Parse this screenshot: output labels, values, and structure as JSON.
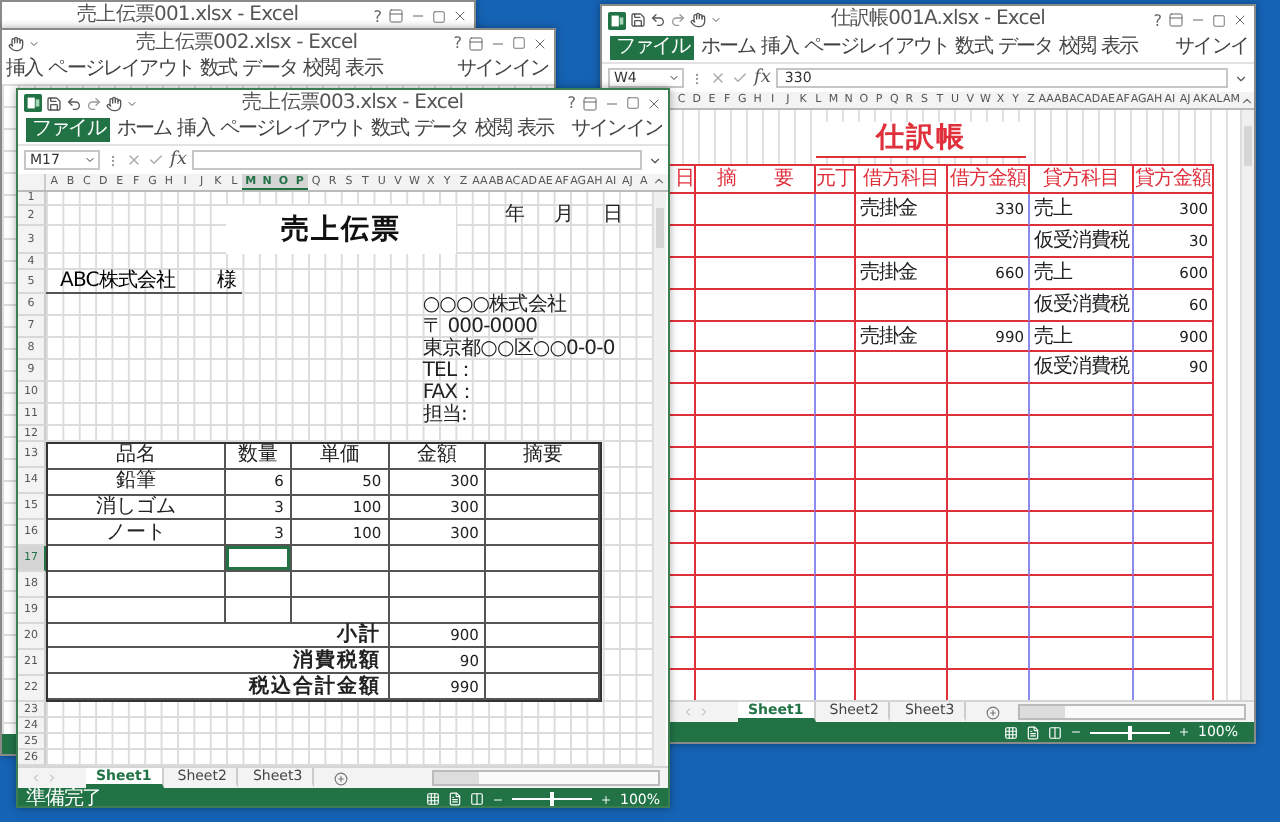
{
  "back_window": {
    "title": "売上伝票001.xlsx - Excel",
    "help": "?"
  },
  "middle_window": {
    "title": "売上伝票002.xlsx - Excel",
    "help": "?",
    "ribbon_tabs": [
      {
        "label": "挿入",
        "kind": "tab"
      },
      {
        "label": "ページレイアウト",
        "kind": "tab"
      },
      {
        "label": "数式",
        "kind": "tab"
      },
      {
        "label": "データ",
        "kind": "tab"
      },
      {
        "label": "校閲",
        "kind": "tab"
      },
      {
        "label": "表示",
        "kind": "tab"
      }
    ],
    "sign_in": "サインイン"
  },
  "journal_window": {
    "title": "仕訳帳001A.xlsx - Excel",
    "help": "?",
    "ribbon_tabs": [
      {
        "label": "ファイル",
        "kind": "file"
      },
      {
        "label": "ホーム",
        "kind": "tab"
      },
      {
        "label": "挿入",
        "kind": "tab"
      },
      {
        "label": "ページレイアウト",
        "kind": "tab"
      },
      {
        "label": "数式",
        "kind": "tab"
      },
      {
        "label": "データ",
        "kind": "tab"
      },
      {
        "label": "校閲",
        "kind": "tab"
      },
      {
        "label": "表示",
        "kind": "tab"
      }
    ],
    "sign_in": "サインイ",
    "name_box": "W4",
    "function_label": "fx",
    "formula": "330",
    "column_letters": [
      "C",
      "D",
      "E",
      "F",
      "G",
      "H",
      "I",
      "J",
      "K",
      "L",
      "M",
      "N",
      "O",
      "P",
      "Q",
      "R",
      "S",
      "T",
      "U",
      "V",
      "W",
      "X",
      "Y",
      "Z",
      "AA",
      "AB",
      "AC",
      "AD",
      "AE",
      "AF",
      "AG",
      "AH",
      "AI",
      "AJ",
      "AK",
      "AL",
      "AM"
    ],
    "sheet": {
      "title": "仕訳帳",
      "columns": [
        "日",
        "摘　　要",
        "元丁",
        "借方科目",
        "借方金額",
        "貸方科目",
        "貸方金額"
      ],
      "entries": [
        {
          "debit_account": "売掛金",
          "debit_amount": "330",
          "credit_account": "売上",
          "credit_amount": "300"
        },
        {
          "credit_account": "仮受消費税",
          "credit_amount": "30"
        },
        {
          "debit_account": "売掛金",
          "debit_amount": "660",
          "credit_account": "売上",
          "credit_amount": "600"
        },
        {
          "credit_account": "仮受消費税",
          "credit_amount": "60"
        },
        {
          "debit_account": "売掛金",
          "debit_amount": "990",
          "credit_account": "売上",
          "credit_amount": "900"
        },
        {
          "credit_account": "仮受消費税",
          "credit_amount": "90"
        }
      ]
    },
    "sheet_tabs": [
      {
        "label": "Sheet1",
        "selected": true
      },
      {
        "label": "Sheet2",
        "selected": false
      },
      {
        "label": "Sheet3",
        "selected": false
      }
    ],
    "zoom_slider": {
      "level": 0.5
    },
    "zoom": "100%"
  },
  "invoice_window": {
    "title": "売上伝票003.xlsx - Excel",
    "help": "?",
    "ribbon_tabs": [
      {
        "label": "ファイル",
        "kind": "file"
      },
      {
        "label": "ホーム",
        "kind": "tab"
      },
      {
        "label": "挿入",
        "kind": "tab"
      },
      {
        "label": "ページレイアウト",
        "kind": "tab"
      },
      {
        "label": "数式",
        "kind": "tab"
      },
      {
        "label": "データ",
        "kind": "tab"
      },
      {
        "label": "校閲",
        "kind": "tab"
      },
      {
        "label": "表示",
        "kind": "tab"
      }
    ],
    "sign_in": "サインイン",
    "name_box": "M17",
    "function_label": "fx",
    "column_letters": [
      {
        "label": "A",
        "selected": false
      },
      {
        "label": "B",
        "selected": false
      },
      {
        "label": "C",
        "selected": false
      },
      {
        "label": "D",
        "selected": false
      },
      {
        "label": "E",
        "selected": false
      },
      {
        "label": "F",
        "selected": false
      },
      {
        "label": "G",
        "selected": false
      },
      {
        "label": "H",
        "selected": false
      },
      {
        "label": "I",
        "selected": false
      },
      {
        "label": "J",
        "selected": false
      },
      {
        "label": "K",
        "selected": false
      },
      {
        "label": "L",
        "selected": false
      },
      {
        "label": "M",
        "selected": true
      },
      {
        "label": "N",
        "selected": true
      },
      {
        "label": "O",
        "selected": true
      },
      {
        "label": "P",
        "selected": true
      },
      {
        "label": "Q",
        "selected": false
      },
      {
        "label": "R",
        "selected": false
      },
      {
        "label": "S",
        "selected": false
      },
      {
        "label": "T",
        "selected": false
      },
      {
        "label": "U",
        "selected": false
      },
      {
        "label": "V",
        "selected": false
      },
      {
        "label": "W",
        "selected": false
      },
      {
        "label": "X",
        "selected": false
      },
      {
        "label": "Y",
        "selected": false
      },
      {
        "label": "Z",
        "selected": false
      },
      {
        "label": "AA",
        "selected": false
      },
      {
        "label": "AB",
        "selected": false
      },
      {
        "label": "AC",
        "selected": false
      },
      {
        "label": "AD",
        "selected": false
      },
      {
        "label": "AE",
        "selected": false
      },
      {
        "label": "AF",
        "selected": false
      },
      {
        "label": "AG",
        "selected": false
      },
      {
        "label": "AH",
        "selected": false
      },
      {
        "label": "AI",
        "selected": false
      },
      {
        "label": "AJ",
        "selected": false
      },
      {
        "label": "A",
        "selected": false
      }
    ],
    "row_numbers": [
      {
        "label": "1",
        "selected": false
      },
      {
        "label": "2",
        "selected": false
      },
      {
        "label": "3",
        "selected": false
      },
      {
        "label": "4",
        "selected": false
      },
      {
        "label": "5",
        "selected": false
      },
      {
        "label": "6",
        "selected": false
      },
      {
        "label": "7",
        "selected": false
      },
      {
        "label": "8",
        "selected": false
      },
      {
        "label": "9",
        "selected": false
      },
      {
        "label": "10",
        "selected": false
      },
      {
        "label": "11",
        "selected": false
      },
      {
        "label": "12",
        "selected": false
      },
      {
        "label": "13",
        "selected": false
      },
      {
        "label": "14",
        "selected": false
      },
      {
        "label": "15",
        "selected": false
      },
      {
        "label": "16",
        "selected": false
      },
      {
        "label": "17",
        "selected": true
      },
      {
        "label": "18",
        "selected": false
      },
      {
        "label": "19",
        "selected": false
      },
      {
        "label": "20",
        "selected": false
      },
      {
        "label": "21",
        "selected": false
      },
      {
        "label": "22",
        "selected": false
      },
      {
        "label": "23",
        "selected": false
      },
      {
        "label": "24",
        "selected": false
      },
      {
        "label": "25",
        "selected": false
      },
      {
        "label": "26",
        "selected": false
      }
    ],
    "sheet": {
      "date_labels": [
        "年",
        "月",
        "日"
      ],
      "title": "売上伝票",
      "customer": "ABC株式会社",
      "honorific": "様",
      "company_lines": [
        "○○○○株式会社",
        "〒 000-0000",
        "東京都○○区○○0-0-0",
        "TEL：",
        "FAX：",
        "担当:"
      ],
      "table": {
        "columns": [
          "品名",
          "数量",
          "単価",
          "金額",
          "摘要"
        ],
        "rows": [
          {
            "name": "鉛筆",
            "quantity": "6",
            "price": "50",
            "amount": "300"
          },
          {
            "name": "消しゴム",
            "quantity": "3",
            "price": "100",
            "amount": "300"
          },
          {
            "name": "ノート",
            "quantity": "3",
            "price": "100",
            "amount": "300"
          }
        ],
        "blank_rows": [
          {
            "quantity_selected": true
          },
          {
            "quantity_selected": false
          },
          {
            "quantity_selected": false
          }
        ],
        "totals": [
          {
            "label": "小計",
            "value": "900"
          },
          {
            "label": "消費税額",
            "value": "90"
          },
          {
            "label": "税込合計金額",
            "value": "990"
          }
        ]
      }
    },
    "sheet_tabs": [
      {
        "label": "Sheet1",
        "selected": true
      },
      {
        "label": "Sheet2",
        "selected": false
      },
      {
        "label": "Sheet3",
        "selected": false
      }
    ],
    "status": "準備完了",
    "zoom_slider": {
      "level": 0.5
    },
    "zoom": "100%"
  }
}
